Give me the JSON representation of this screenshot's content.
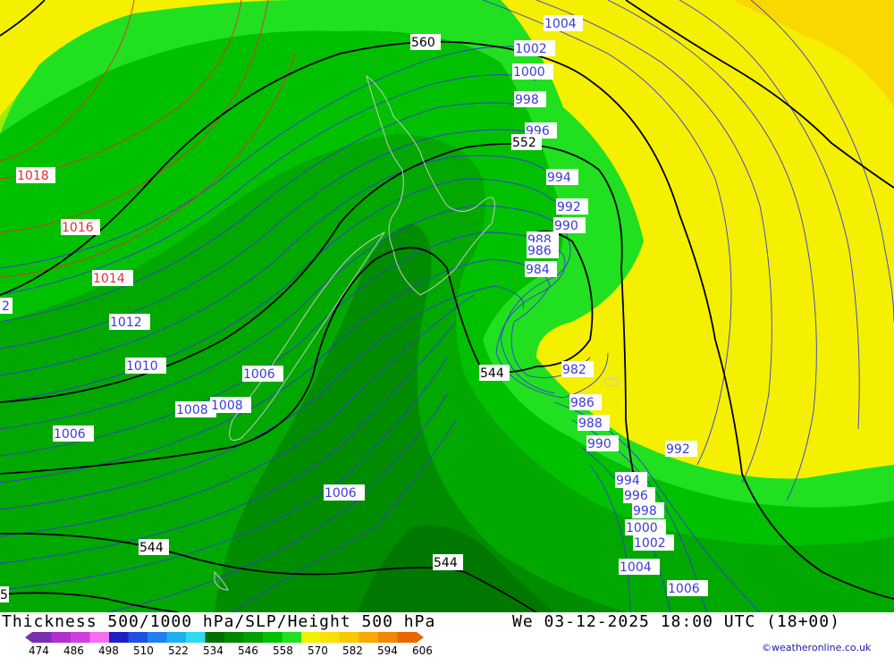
{
  "title": "Thickness 500/1000 hPa/SLP/Height 500 hPa",
  "datetime": "We 03-12-2025 18:00 UTC (18+00)",
  "credit": "©weatheronline.co.uk",
  "scale": {
    "ticks": [
      "474",
      "486",
      "498",
      "510",
      "522",
      "534",
      "546",
      "558",
      "570",
      "582",
      "594",
      "606"
    ],
    "colors": [
      "#7a2fb0",
      "#b030d0",
      "#d040e0",
      "#f070f0",
      "#2020c0",
      "#2050e0",
      "#2080f0",
      "#20b0f0",
      "#30d8f0",
      "#007000",
      "#008800",
      "#00a000",
      "#00c000",
      "#20e020",
      "#f0f000",
      "#f8e000",
      "#f8c800",
      "#f8a800",
      "#f08800",
      "#e86800"
    ]
  },
  "map": {
    "slp_labels_red": [
      "1018",
      "1016",
      "1014"
    ],
    "slp_labels_blue": [
      "1004",
      "1002",
      "1000",
      "998",
      "996",
      "994",
      "992",
      "990",
      "988",
      "986",
      "984",
      "982",
      "986",
      "988",
      "990",
      "992",
      "994",
      "996",
      "998",
      "1000",
      "1002",
      "1004",
      "1006",
      "1012",
      "1010",
      "1006",
      "1008",
      "1008",
      "1006",
      "1006",
      "2",
      "1006"
    ],
    "height_labels": [
      "560",
      "552",
      "544",
      "544",
      "544",
      "5"
    ]
  }
}
